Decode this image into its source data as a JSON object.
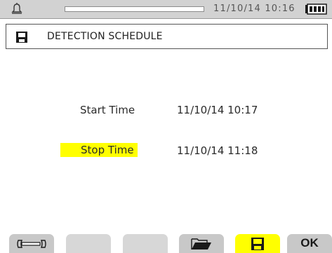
{
  "status_bar": {
    "clock": "11/10/14  10:16",
    "icons": [
      "bell-icon",
      "battery-icon"
    ]
  },
  "header": {
    "title": "DETECTION SCHEDULE",
    "icon": "save-icon"
  },
  "fields": {
    "start": {
      "label": "Start Time",
      "value": "11/10/14 10:17"
    },
    "stop": {
      "label": "Stop Time",
      "value": "11/10/14 11:18",
      "highlight": "#ffff00"
    }
  },
  "function_keys": [
    {
      "icon": "wrench-icon",
      "state": "normal"
    },
    {
      "icon": "",
      "state": "disabled"
    },
    {
      "icon": "",
      "state": "disabled"
    },
    {
      "icon": "folder-open-icon",
      "state": "normal"
    },
    {
      "icon": "save-icon",
      "state": "active"
    },
    {
      "label": "OK",
      "state": "normal"
    }
  ],
  "colors": {
    "highlight": "#ffff00",
    "status_bar": "#d2d2d2",
    "key": "#c8c8c8"
  }
}
